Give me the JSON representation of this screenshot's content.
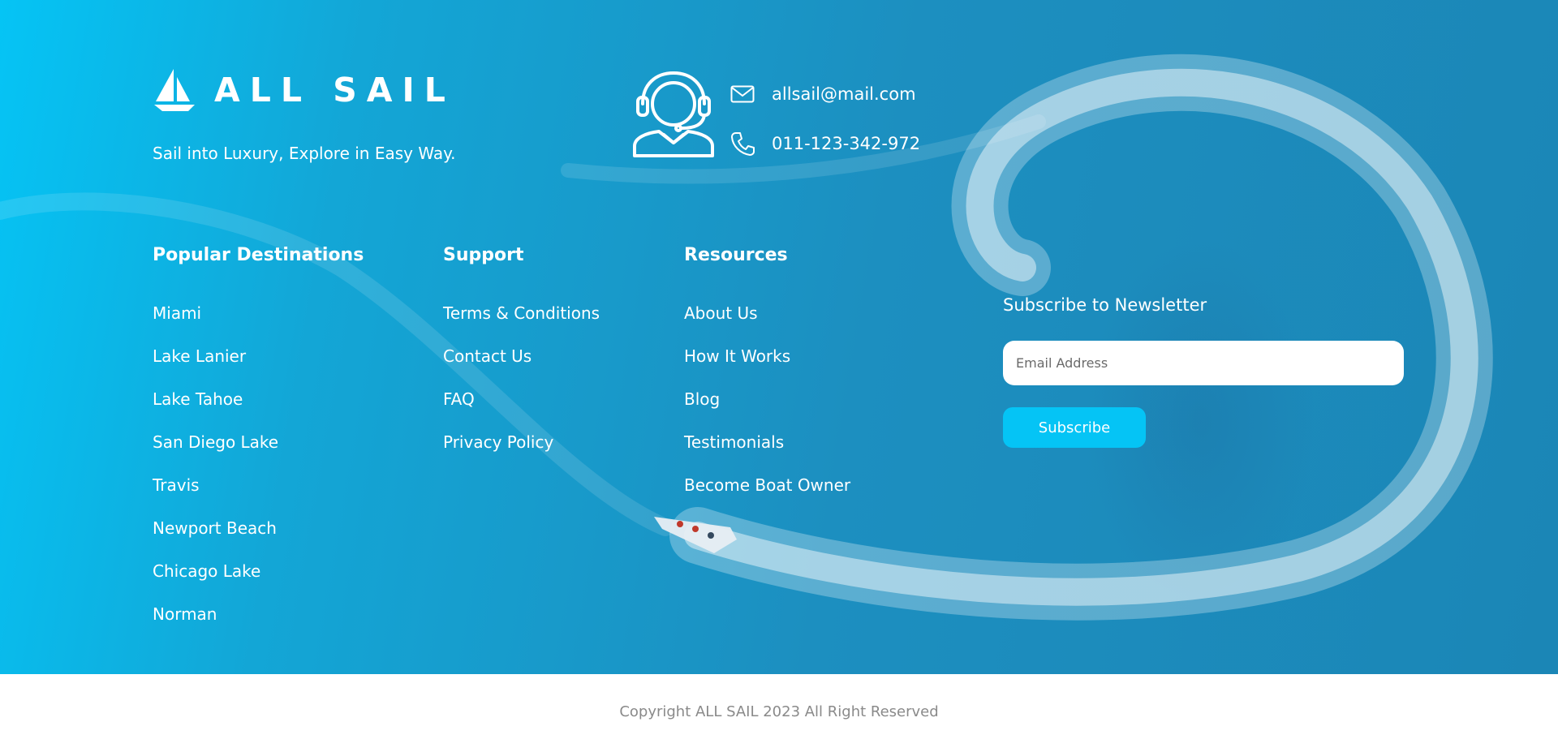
{
  "brand": {
    "name": "ALL SAIL",
    "tagline": "Sail into Luxury, Explore in Easy Way."
  },
  "contact": {
    "email": "allsail@mail.com",
    "phone": "011-123-342-972"
  },
  "columns": [
    {
      "title": "Popular Destinations",
      "links": [
        "Miami",
        "Lake Lanier",
        "Lake Tahoe",
        "San Diego Lake",
        "Travis",
        "Newport Beach",
        "Chicago Lake",
        "Norman"
      ]
    },
    {
      "title": "Support",
      "links": [
        "Terms & Conditions",
        "Contact Us",
        "FAQ",
        "Privacy Policy"
      ]
    },
    {
      "title": "Resources",
      "links": [
        "About Us",
        "How It Works",
        "Blog",
        "Testimonials",
        "Become Boat Owner"
      ]
    }
  ],
  "newsletter": {
    "title": "Subscribe to Newsletter",
    "placeholder": "Email Address",
    "button_label": "Subscribe"
  },
  "copyright": "Copyright ALL SAIL 2023 All Right Reserved",
  "colors": {
    "accent": "#05c4f5",
    "sea": "#1b8bbc",
    "text_light": "#ffffff",
    "copyright_text": "#8a8a8a"
  }
}
